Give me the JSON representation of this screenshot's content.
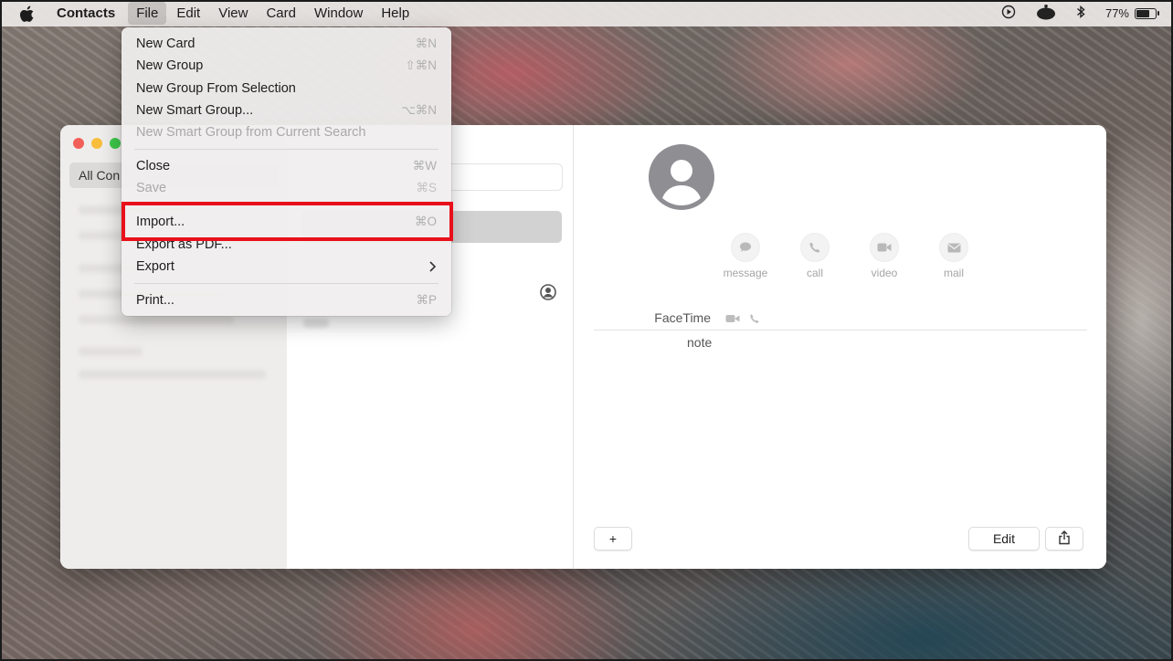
{
  "menubar": {
    "app_name": "Contacts",
    "menus": [
      "File",
      "Edit",
      "View",
      "Card",
      "Window",
      "Help"
    ],
    "active_menu": "File",
    "battery_percent": "77%",
    "battery_level": 0.77,
    "icons": [
      "apple-icon",
      "play-icon",
      "status-app-icon",
      "bluetooth-icon",
      "battery-icon"
    ]
  },
  "file_menu": {
    "items": [
      {
        "label": "New Card",
        "shortcut": "⌘N",
        "enabled": true
      },
      {
        "label": "New Group",
        "shortcut": "⇧⌘N",
        "enabled": true
      },
      {
        "label": "New Group From Selection",
        "shortcut": "",
        "enabled": true
      },
      {
        "label": "New Smart Group...",
        "shortcut": "⌥⌘N",
        "enabled": true
      },
      {
        "label": "New Smart Group from Current Search",
        "shortcut": "",
        "enabled": false
      },
      {
        "label": "Close",
        "shortcut": "⌘W",
        "enabled": true
      },
      {
        "label": "Save",
        "shortcut": "⌘S",
        "enabled": false
      },
      {
        "label": "Import...",
        "shortcut": "⌘O",
        "enabled": true,
        "highlighted": true
      },
      {
        "label": "Export as PDF...",
        "shortcut": "",
        "enabled": true
      },
      {
        "label": "Export",
        "shortcut": "",
        "enabled": true,
        "submenu": true
      },
      {
        "label": "Print...",
        "shortcut": "⌘P",
        "enabled": true
      }
    ]
  },
  "sidebar": {
    "selected_label": "All Con"
  },
  "detail": {
    "actions": [
      {
        "label": "message",
        "icon": "message-icon"
      },
      {
        "label": "call",
        "icon": "phone-icon"
      },
      {
        "label": "video",
        "icon": "video-icon"
      },
      {
        "label": "mail",
        "icon": "mail-icon"
      }
    ],
    "facetime_label": "FaceTime",
    "note_label": "note",
    "add_label": "+",
    "edit_label": "Edit"
  },
  "colors": {
    "highlight_border": "#e8101b",
    "traffic_red": "#f25f58",
    "traffic_yellow": "#f8bd3b",
    "traffic_green": "#3ec84a"
  }
}
